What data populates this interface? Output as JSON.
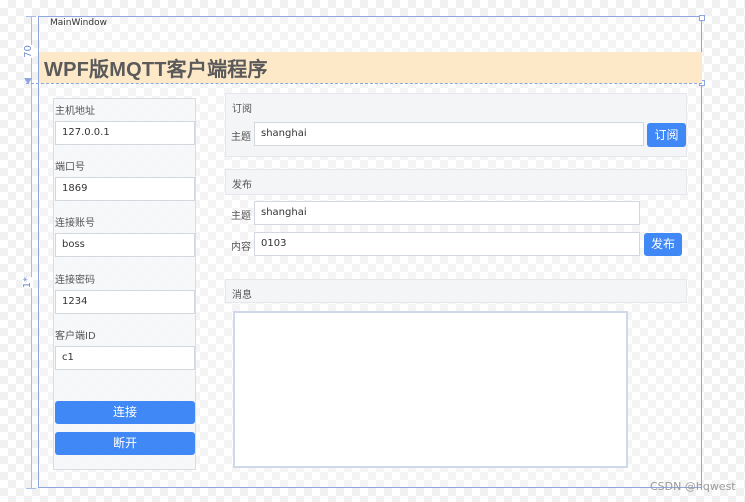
{
  "window": {
    "title": "MainWindow"
  },
  "designer": {
    "row_height_label": "70",
    "star_label": "1*"
  },
  "header": {
    "title": "WPF版MQTT客户端程序"
  },
  "connection": {
    "host_label": "主机地址",
    "host_value": "127.0.0.1",
    "port_label": "端口号",
    "port_value": "1869",
    "account_label": "连接账号",
    "account_value": "boss",
    "password_label": "连接密码",
    "password_value": "1234",
    "client_id_label": "客户端ID",
    "client_id_value": "c1",
    "connect_label": "连接",
    "disconnect_label": "断开"
  },
  "subscribe": {
    "section_label": "订阅",
    "topic_label": "主题",
    "topic_value": "shanghai",
    "button_label": "订阅"
  },
  "publish": {
    "section_label": "发布",
    "topic_label": "主题",
    "topic_value": "shanghai",
    "content_label": "内容",
    "content_value": "0103",
    "button_label": "发布"
  },
  "messages": {
    "section_label": "消息",
    "content": ""
  },
  "watermark": "CSDN @hqwest",
  "colors": {
    "accent": "#4088f5",
    "banner": "#fde8c7",
    "designer_guide": "#8da6df"
  }
}
